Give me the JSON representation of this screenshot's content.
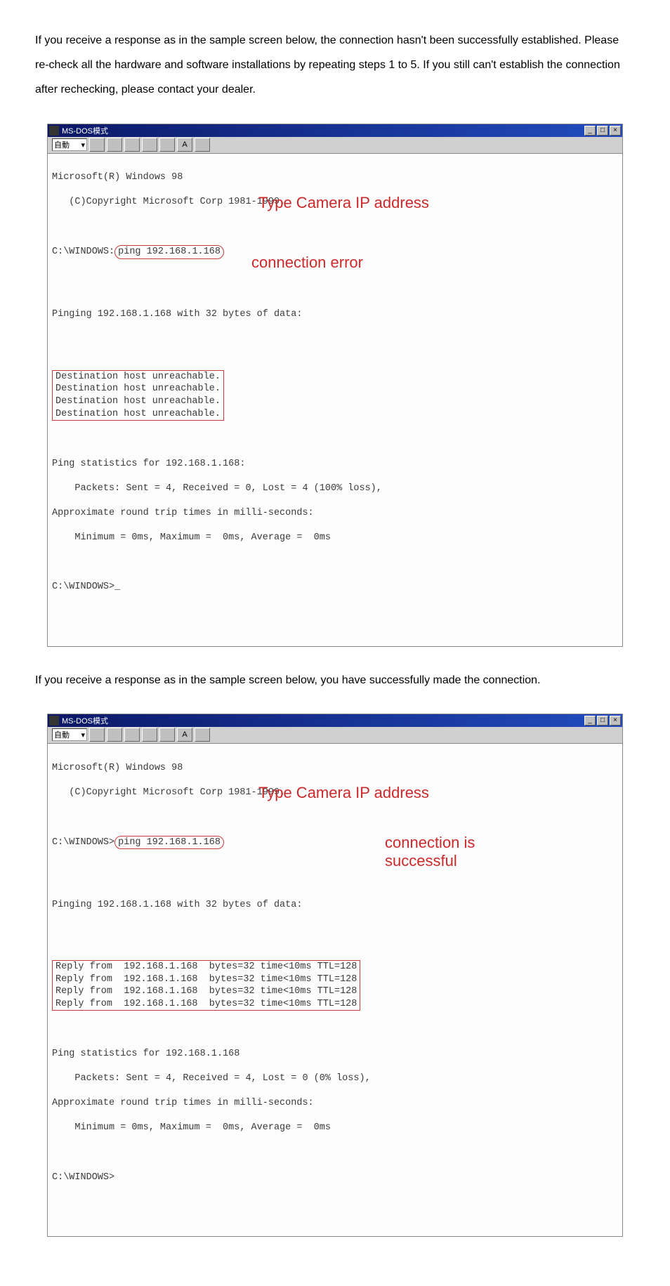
{
  "paragraph1": "If you receive a response as in the sample screen below, the connection hasn't been successfully established. Please re-check all the hardware and software installations by repeating steps 1 to 5. If you still can't establish the connection after rechecking, please contact your dealer.",
  "paragraph2": "If you receive a response as in the sample screen below, you have successfully made the connection.",
  "window1": {
    "title": "MS-DOS模式",
    "winbtns": {
      "min": "_",
      "max": "□",
      "close": "×"
    },
    "toolbar": {
      "select": "自動",
      "chevron": "▾"
    },
    "copyright1": "Microsoft(R) Windows 98",
    "copyright2": "   (C)Copyright Microsoft Corp 1981-1999.",
    "promptprefix": "C:\\WINDOWS:",
    "promptcmd": "ping 192.168.1.168",
    "anno_type": "Type Camera IP address",
    "pingingline": "Pinging 192.168.1.168 with 32 bytes of data:",
    "du1": "Destination host unreachable.",
    "du2": "Destination host unreachable.",
    "du3": "Destination host unreachable.",
    "du4": "Destination host unreachable.",
    "anno_err": "connection error",
    "stat1": "Ping statistics for 192.168.1.168:",
    "stat2": "    Packets: Sent = 4, Received = 0, Lost = 4 (100% loss),",
    "stat3": "Approximate round trip times in milli-seconds:",
    "stat4": "    Minimum = 0ms, Maximum =  0ms, Average =  0ms",
    "promptend": "C:\\WINDOWS>_"
  },
  "window2": {
    "title": "MS-DOS模式",
    "winbtns": {
      "min": "_",
      "max": "□",
      "close": "×"
    },
    "toolbar": {
      "select": "自動",
      "chevron": "▾"
    },
    "copyright1": "Microsoft(R) Windows 98",
    "copyright2": "   (C)Copyright Microsoft Corp 1981-1999.",
    "promptprefix": "C:\\WINDOWS>",
    "promptcmd": "ping 192.168.1.168",
    "anno_type": "Type Camera IP address",
    "pingingline": "Pinging 192.168.1.168 with 32 bytes of data:",
    "r1": "Reply from  192.168.1.168  bytes=32 time<10ms TTL=128",
    "r2": "Reply from  192.168.1.168  bytes=32 time<10ms TTL=128",
    "r3": "Reply from  192.168.1.168  bytes=32 time<10ms TTL=128",
    "r4": "Reply from  192.168.1.168  bytes=32 time<10ms TTL=128",
    "anno_ok1": "connection is",
    "anno_ok2": "successful",
    "stat1": "Ping statistics for 192.168.1.168",
    "stat2": "    Packets: Sent = 4, Received = 4, Lost = 0 (0% loss),",
    "stat3": "Approximate round trip times in milli-seconds:",
    "stat4": "    Minimum = 0ms, Maximum =  0ms, Average =  0ms",
    "promptend": "C:\\WINDOWS>"
  }
}
